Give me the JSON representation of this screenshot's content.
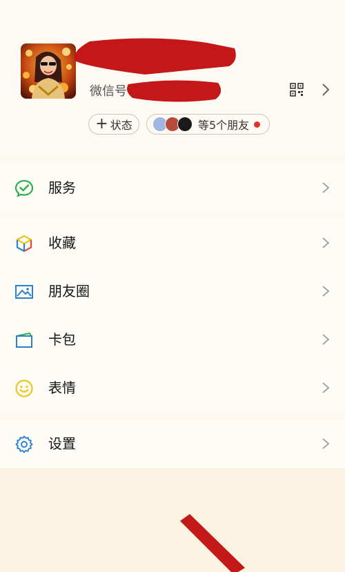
{
  "profile": {
    "wechat_id_label": "微信号",
    "status_button_label": "状态",
    "status_button_icon": "plus-icon",
    "friends_text": "等5个朋友",
    "qr_icon": "qr-code-icon",
    "chevron_icon": "chevron-right-icon"
  },
  "menu": {
    "services": {
      "label": "服务",
      "icon": "wechat-pay-icon"
    },
    "favorites": {
      "label": "收藏",
      "icon": "cube-icon"
    },
    "moments": {
      "label": "朋友圈",
      "icon": "image-icon"
    },
    "cards": {
      "label": "卡包",
      "icon": "wallet-icon"
    },
    "stickers": {
      "label": "表情",
      "icon": "smiley-icon"
    },
    "settings": {
      "label": "设置",
      "icon": "gear-icon"
    }
  },
  "colors": {
    "background": "#fcf8f0",
    "redaction": "#c41818",
    "green": "#2bb04a",
    "blue": "#2b7fd0",
    "yellow": "#f0c419",
    "notification_dot": "#e3322b"
  }
}
